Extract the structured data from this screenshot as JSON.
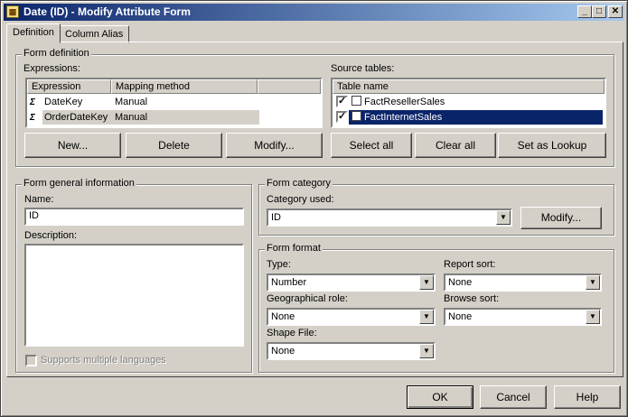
{
  "window": {
    "title": "Date (ID) - Modify Attribute Form",
    "app_icon": "attribute-icon"
  },
  "tabs": [
    {
      "label": "Definition",
      "active": true
    },
    {
      "label": "Column Alias",
      "active": false
    }
  ],
  "form_definition": {
    "group_label": "Form definition",
    "expressions_label": "Expressions:",
    "columns": [
      "Expression",
      "Mapping method"
    ],
    "rows": [
      {
        "expression": "DateKey",
        "mapping": "Manual"
      },
      {
        "expression": "OrderDateKey",
        "mapping": "Manual"
      }
    ],
    "source_tables_label": "Source tables:",
    "table_column": "Table name",
    "tables": [
      {
        "name": "FactResellerSales",
        "checked": true,
        "selected": false
      },
      {
        "name": "FactInternetSales",
        "checked": true,
        "selected": true
      }
    ],
    "buttons": {
      "new": "New...",
      "delete": "Delete",
      "modify": "Modify...",
      "select_all": "Select all",
      "clear_all": "Clear all",
      "set_as_lookup": "Set as Lookup"
    }
  },
  "general_info": {
    "group_label": "Form general information",
    "name_label": "Name:",
    "name_value": "ID",
    "description_label": "Description:",
    "description_value": "",
    "multi_lang_label": "Supports multiple languages"
  },
  "category": {
    "group_label": "Form category",
    "category_label": "Category used:",
    "category_value": "ID",
    "modify_button": "Modify..."
  },
  "format": {
    "group_label": "Form format",
    "type_label": "Type:",
    "type_value": "Number",
    "report_sort_label": "Report sort:",
    "report_sort_value": "None",
    "geo_role_label": "Geographical role:",
    "geo_role_value": "None",
    "browse_sort_label": "Browse sort:",
    "browse_sort_value": "None",
    "shape_file_label": "Shape File:",
    "shape_file_value": "None"
  },
  "footer": {
    "ok": "OK",
    "cancel": "Cancel",
    "help": "Help"
  }
}
